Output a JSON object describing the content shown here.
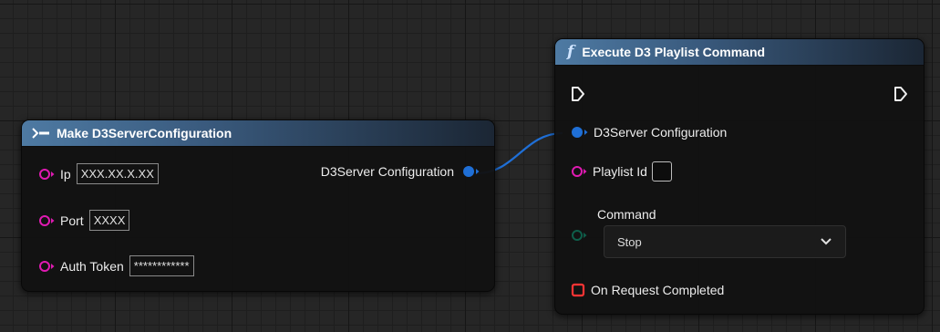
{
  "colors": {
    "struct_pin": "#1f6fd6",
    "string_pin": "#e01ab2",
    "enum_pin": "#0e5e4a",
    "delegate_pin": "#ff3434",
    "header_blue": "#4e7aa3",
    "wire": "#1f6fd6"
  },
  "make_node": {
    "title": "Make D3ServerConfiguration",
    "icon": "make-struct-icon",
    "inputs": [
      {
        "label": "Ip",
        "value": "XXX.XX.X.XX"
      },
      {
        "label": "Port",
        "value": "XXXX"
      },
      {
        "label": "Auth Token",
        "value": "************"
      }
    ],
    "output_label": "D3Server Configuration"
  },
  "exec_node": {
    "title": "Execute D3 Playlist Command",
    "icon": "function-icon",
    "icon_glyph": "f",
    "config_label": "D3Server Configuration",
    "playlist_label": "Playlist Id",
    "command_label": "Command",
    "command_value": "Stop",
    "completed_label": "On Request Completed"
  }
}
